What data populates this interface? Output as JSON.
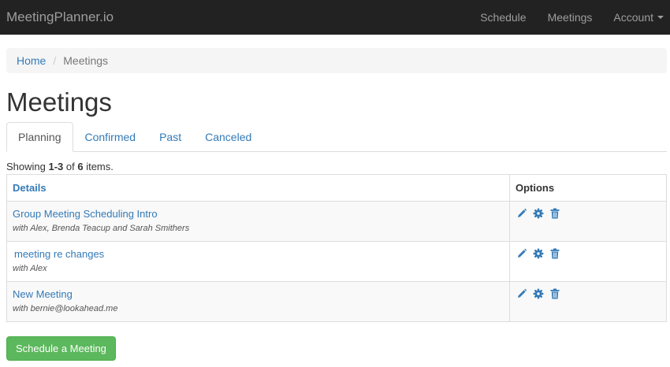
{
  "navbar": {
    "brand": "MeetingPlanner.io",
    "links": [
      "Schedule",
      "Meetings",
      "Account"
    ],
    "bg_color": "#222222",
    "text_color": "#9d9d9d"
  },
  "breadcrumb": {
    "home": "Home",
    "separator": "/",
    "current": "Meetings"
  },
  "page": {
    "title": "Meetings"
  },
  "tabs": [
    {
      "label": "Planning",
      "active": true
    },
    {
      "label": "Confirmed",
      "active": false
    },
    {
      "label": "Past",
      "active": false
    },
    {
      "label": "Canceled",
      "active": false
    }
  ],
  "summary": {
    "prefix": "Showing ",
    "range": "1-3",
    "of": " of ",
    "total": "6",
    "suffix": " items."
  },
  "table": {
    "headers": {
      "details": "Details",
      "options": "Options"
    },
    "rows": [
      {
        "title": "Group Meeting Scheduling Intro",
        "subtitle": "with Alex, Brenda Teacup and Sarah Smithers",
        "icons": [
          "pencil-icon",
          "gear-icon",
          "trash-icon"
        ]
      },
      {
        "title": "meeting re changes",
        "subtitle": "with Alex",
        "icons": [
          "pencil-icon",
          "gear-icon",
          "trash-icon"
        ]
      },
      {
        "title": "New Meeting",
        "subtitle": "with bernie@lookahead.me",
        "icons": [
          "pencil-icon",
          "gear-icon",
          "trash-icon"
        ]
      }
    ]
  },
  "actions": {
    "schedule_button": "Schedule a Meeting",
    "button_color": "#5cb85c"
  },
  "colors": {
    "link": "#337ab7",
    "text": "#333333"
  }
}
